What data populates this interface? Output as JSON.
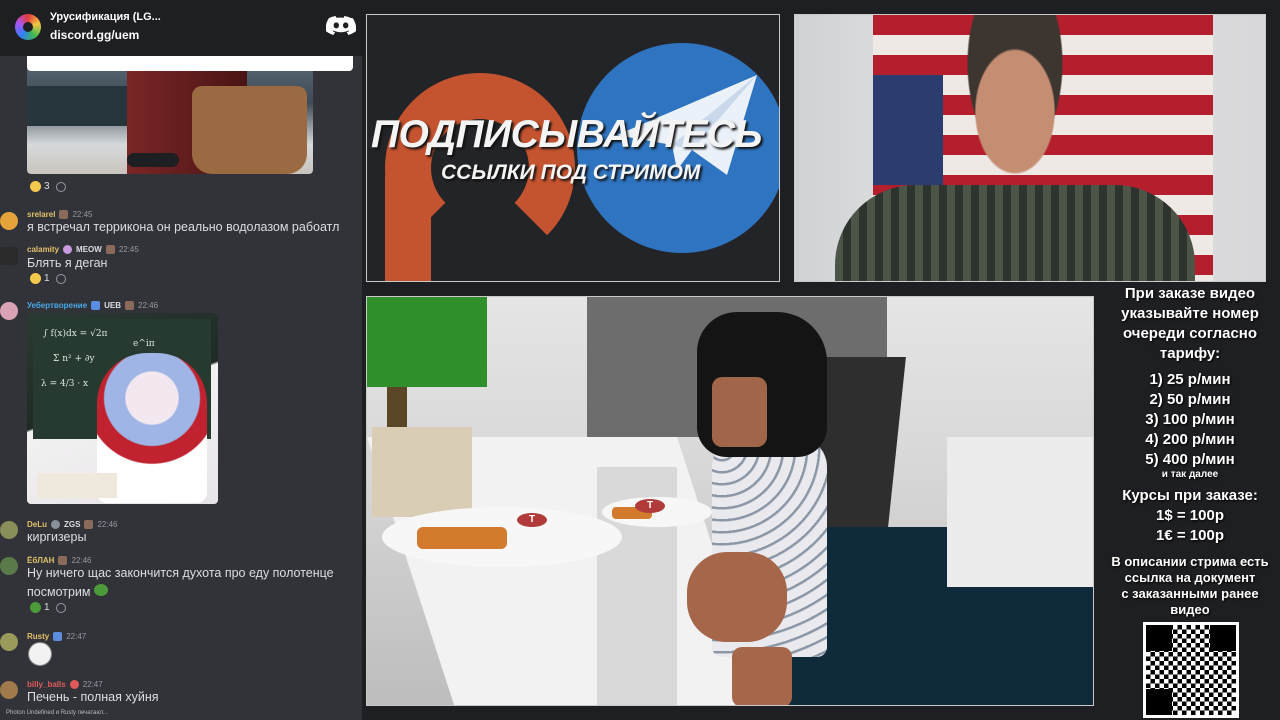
{
  "server": {
    "name": "Урусификация (LG...",
    "invite": "discord.gg/uem",
    "icon": "discord-icon"
  },
  "messages": [
    {
      "id": "video",
      "reactions": [
        {
          "emoji": "laughing-emoji",
          "count": "3"
        }
      ]
    },
    {
      "id": "m1",
      "username": "srelarel",
      "username_color": "#e0c06a",
      "time": "22:45",
      "text": "я встречал террикона он реально водолазом рабоатл"
    },
    {
      "id": "m2",
      "username": "calamity",
      "username_color": "#e0c06a",
      "tag": "MEOW",
      "time": "22:45",
      "text": "Блять я деган",
      "reactions": [
        {
          "emoji": "ok-hand-emoji",
          "count": "1"
        }
      ]
    },
    {
      "id": "m3",
      "username": "Уебертворение",
      "username_color": "#4aa8e8",
      "tag": "UEB",
      "time": "22:46",
      "text": ""
    },
    {
      "id": "m4",
      "username": "DeLu",
      "username_color": "#e0c06a",
      "tag": "ZGS",
      "time": "22:46",
      "text": "киргизеры"
    },
    {
      "id": "m5",
      "username": "ЁбЛАН",
      "username_color": "#e0c06a",
      "time": "22:46",
      "text": "Ну ничего щас закончится духота про еду полотенце",
      "text2": "посмотрим",
      "reactions": [
        {
          "emoji": "frog-emoji",
          "count": "1"
        }
      ]
    },
    {
      "id": "m6",
      "username": "Rusty",
      "username_color": "#e0c06a",
      "time": "22:47",
      "text": ""
    },
    {
      "id": "m7",
      "username": "billy_balls",
      "username_color": "#e05a5a",
      "time": "22:47",
      "text": "Печень - полная хуйня"
    }
  ],
  "typing": "Photon Undefined и Rusty печатают...",
  "banner": {
    "title": "ПОДПИСЫВАЙТЕСЬ",
    "subtitle": "ССЫЛКИ ПОД СТРИМОМ",
    "patreon_color": "#c4532f",
    "telegram_color": "#2f74c0"
  },
  "game": {
    "plate_badge_1": "T",
    "plate_badge_2": "T"
  },
  "info": {
    "intro": [
      "При заказе видео",
      "указывайте номер",
      "очереди согласно",
      "тарифу:"
    ],
    "tariffs": [
      "1) 25 р/мин",
      "2) 50 р/мин",
      "3) 100 р/мин",
      "4) 200 р/мин",
      "5) 400 р/мин"
    ],
    "tariffs_more": "и так далее",
    "rates_title": "Курсы при заказе:",
    "rates": [
      "1$ = 100р",
      "1€ = 100р"
    ],
    "doc_note": [
      "В описании стрима есть",
      "ссылка на документ",
      "с заказанными ранее",
      "видео"
    ]
  }
}
